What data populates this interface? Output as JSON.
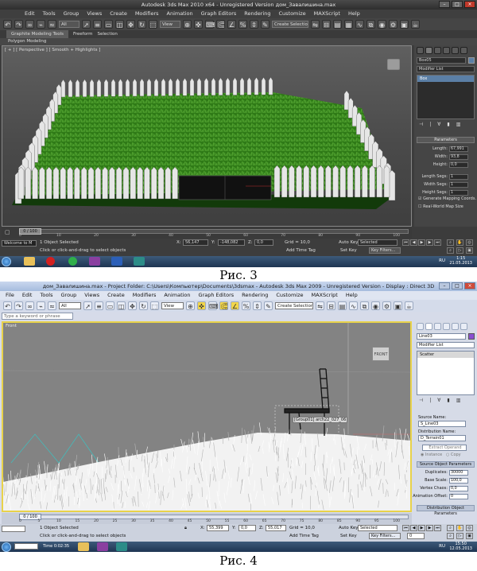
{
  "figure1": {
    "caption": "Рис. 3",
    "title": "Autodesk 3ds Max  2010 x64  -  Unregistered Version   дом_Завалишина.max",
    "menu": [
      "Edit",
      "Tools",
      "Group",
      "Views",
      "Create",
      "Modifiers",
      "Animation",
      "Graph Editors",
      "Rendering",
      "Customize",
      "MAXScript",
      "Help"
    ],
    "toolbar": {
      "filter": "All",
      "view": "View",
      "selection_set": "Create Selection Set"
    },
    "ribbon_tabs": [
      "Graphite Modeling Tools",
      "Freeform",
      "Selection"
    ],
    "ribbon_sub": "Polygon Modeling",
    "viewport_label": "[ + ] [ Perspective ] [ Smooth + Highlights ]",
    "panel": {
      "object_name": "Box05",
      "modifier_list": "Modifier List",
      "stack_item": "Box",
      "rollout": "Parameters",
      "params": [
        {
          "label": "Length:",
          "value": "67,991"
        },
        {
          "label": "Width:",
          "value": "93,8"
        },
        {
          "label": "Height:",
          "value": "0,0"
        },
        {
          "label": "Length Segs:",
          "value": "1"
        },
        {
          "label": "Width Segs:",
          "value": "1"
        },
        {
          "label": "Height Segs:",
          "value": "1"
        }
      ],
      "checks": [
        {
          "label": "Generate Mapping Coords.",
          "checked": true
        },
        {
          "label": "Real-World Map Size",
          "checked": false
        }
      ]
    },
    "timeline": {
      "slider": "0 / 100",
      "ticks": [
        "0",
        "10",
        "20",
        "30",
        "40",
        "50",
        "60",
        "70",
        "80",
        "90",
        "100"
      ]
    },
    "status": {
      "selected": "1 Object Selected",
      "prompt": "Click or click-and-drag to select objects",
      "listener": "Welcome to M",
      "x": "56,147",
      "y": "-148,082",
      "z": "0,0",
      "grid": "Grid = 10,0",
      "add_time_tag": "Add Time Tag",
      "auto_key": "Auto Key",
      "set_key": "Set Key",
      "selected_dd": "Selected",
      "key_filters": "Key Filters..."
    },
    "taskbar": {
      "lang": "RU",
      "time": "1:15",
      "date": "21.05.2013"
    }
  },
  "figure2": {
    "caption": "Рис. 4",
    "title": "дом_Завалишина.max   -  Project Folder: C:\\Users\\Компьютер\\Documents\\3dsmax   -  Autodesk 3ds Max  2009   -  Unregistered Version   - Display : Direct 3D",
    "menu": [
      "File",
      "Edit",
      "Tools",
      "Group",
      "Views",
      "Create",
      "Modifiers",
      "Animation",
      "Graph Editors",
      "Rendering",
      "Customize",
      "MAXScript",
      "Help"
    ],
    "toolbar": {
      "filter": "All",
      "view": "View",
      "selection_set": "Create Selection Set"
    },
    "search_placeholder": "Type a keyword or phrase",
    "viewport_label": "Front",
    "viewcube_label": "FRONT",
    "object_label": "[Group01] arch22_027_06",
    "panel": {
      "object_name": "Line03",
      "modifier_list": "Modifier List",
      "stack_item": "Scatter",
      "source_label": "Source Name:",
      "source_value": "S_Line03",
      "dist_label": "Distribution Name:",
      "dist_value": "D_Terrain01",
      "extract": "Extract Operand",
      "instance": "Instance",
      "copy": "Copy",
      "rollout": "Source Object Parameters",
      "params": [
        {
          "label": "Duplicates:",
          "value": "30000"
        },
        {
          "label": "Base Scale:",
          "value": "100,0"
        },
        {
          "label": "Vertex Chaos:",
          "value": "0,0"
        },
        {
          "label": "Animation Offset:",
          "value": "0"
        }
      ],
      "rollout2": "Distribution Object Parameters"
    },
    "timeline": {
      "slider": "0 / 100",
      "ticks": [
        "0",
        "5",
        "10",
        "15",
        "20",
        "25",
        "30",
        "35",
        "40",
        "45",
        "50",
        "55",
        "60",
        "65",
        "70",
        "75",
        "80",
        "85",
        "90",
        "95",
        "100"
      ]
    },
    "status": {
      "selected": "1 Object Selected",
      "prompt": "Click or click-and-drag to select objects",
      "time": "Time  0:02:35",
      "x": "55,399",
      "y": "0,0",
      "z": "55,017",
      "grid": "Grid = 10,0",
      "add_time_tag": "Add Time Tag",
      "auto_key": "Auto Key",
      "set_key": "Set Key",
      "selected_dd": "Selected",
      "key_filters": "Key Filters...",
      "frame": "0"
    },
    "taskbar": {
      "lang": "RU",
      "time": "15:50",
      "date": "12.05.2013"
    }
  }
}
